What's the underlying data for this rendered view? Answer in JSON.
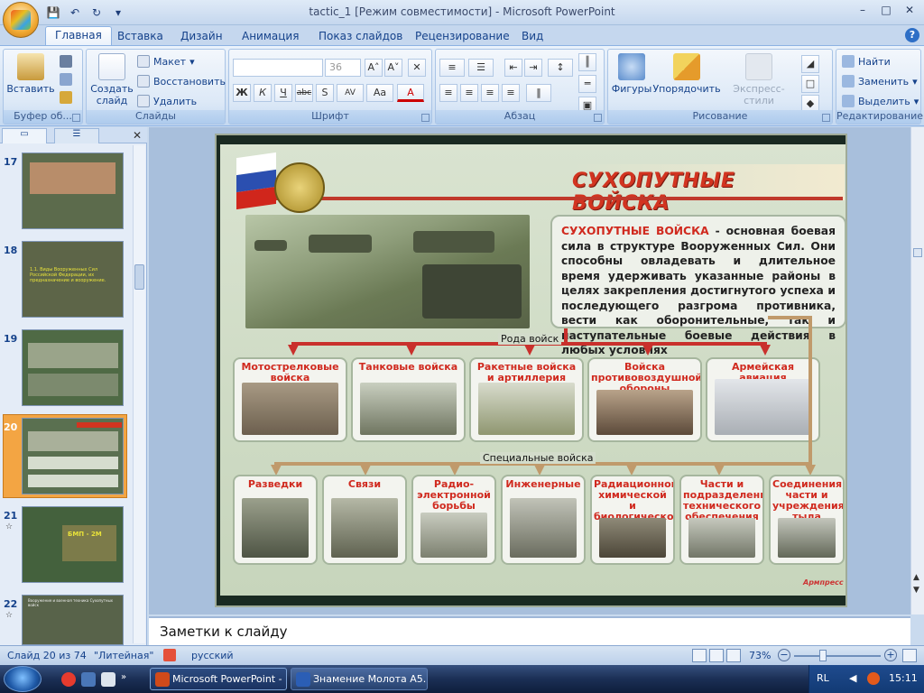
{
  "window": {
    "title": "tactic_1 [Режим совместимости] - Microsoft PowerPoint",
    "controls": [
      "minimize",
      "maximize",
      "close"
    ]
  },
  "qat": {
    "icons": [
      "save-icon",
      "undo-icon",
      "redo-icon",
      "customize-icon"
    ]
  },
  "tabs": [
    {
      "label": "Главная",
      "active": true
    },
    {
      "label": "Вставка"
    },
    {
      "label": "Дизайн"
    },
    {
      "label": "Анимация"
    },
    {
      "label": "Показ слайдов"
    },
    {
      "label": "Рецензирование"
    },
    {
      "label": "Вид"
    }
  ],
  "ribbon": {
    "clipboard": {
      "label": "Буфер об...",
      "paste": "Вставить"
    },
    "slides": {
      "label": "Слайды",
      "create": "Создать слайд",
      "layout": "Макет",
      "restore": "Восстановить",
      "delete": "Удалить"
    },
    "font": {
      "label": "Шрифт",
      "size": "36",
      "bold": "Ж",
      "italic": "К",
      "underline": "Ч",
      "strike": "abc",
      "shadow": "S",
      "spacing": "AV",
      "case": "Aa",
      "color": "A"
    },
    "paragraph": {
      "label": "Абзац"
    },
    "drawing": {
      "label": "Рисование",
      "shapes": "Фигуры",
      "arrange": "Упорядочить",
      "styles": "Экспресс-стили"
    },
    "editing": {
      "label": "Редактирование",
      "find": "Найти",
      "replace": "Заменить",
      "select": "Выделить"
    }
  },
  "slide_pane": {
    "thumbnails": [
      {
        "num": "17",
        "bg": "#5c6b4c"
      },
      {
        "num": "18",
        "bg": "#5d6548",
        "text": "1.1. Виды Вооруженных Сил Российской Федерации, их предназначение и вооружение."
      },
      {
        "num": "19",
        "bg": "#4f6a45"
      },
      {
        "num": "20",
        "bg": "#5a7050",
        "selected": true
      },
      {
        "num": "21",
        "bg": "#44613d",
        "text": "БМП - 2М"
      },
      {
        "num": "22",
        "bg": "#58634a",
        "text": "Вооружение и военная техника Сухопутных войск"
      }
    ]
  },
  "slide": {
    "title": "СУХОПУТНЫЕ ВОЙСКА",
    "desc_highlight": "СУХОПУТНЫЕ ВОЙСКА",
    "desc_text": " - основная боевая сила в структуре Вооруженных Сил. Они способны овладевать и длительное время удерживать указанные районы в целях закрепления достигнутого успеха и последующего разгрома противника, вести как оборонительные, так и наступательные боевые действия в любых условиях",
    "branches_label": "Рода войск",
    "special_label": "Специальные войска",
    "branches": [
      "Мотострелковые войска",
      "Танковые войска",
      "Ракетные войска и артиллерия",
      "Войска противовоздушной обороны",
      "Армейская авиация"
    ],
    "special": [
      "Разведки",
      "Связи",
      "Радио-электронной борьбы",
      "Инженерные",
      "Радиационной, химической и биологической защиты",
      "Части и подразделения технического обеспечения",
      "Соединения, части и учреждения тыла"
    ],
    "publisher": "Армпресс"
  },
  "notes": {
    "placeholder": "Заметки к слайду"
  },
  "status": {
    "slide_counter": "Слайд 20 из 74",
    "theme": "\"Литейная\"",
    "language": "русский",
    "zoom": "73%",
    "zoom_level": 0.73
  },
  "taskbar": {
    "tasks": [
      {
        "label": "Microsoft PowerPoint - ...",
        "active": true
      },
      {
        "label": "Знамение Молота А5..."
      }
    ],
    "lang": "RL",
    "time": "15:11"
  }
}
